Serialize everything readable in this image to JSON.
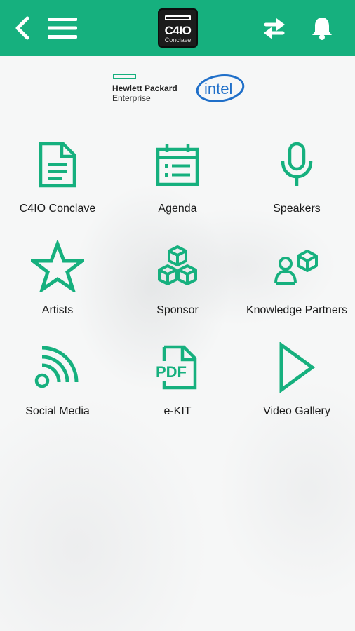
{
  "colors": {
    "accent": "#16b07e",
    "header_bg": "#16b07e",
    "text": "#1a1a1a"
  },
  "header": {
    "back_icon": "back-arrow-icon",
    "menu_icon": "hamburger-menu-icon",
    "logo": {
      "line1": "C4IO",
      "line2": "Conclave"
    },
    "sync_icon": "sync-icon",
    "notification_icon": "bell-icon"
  },
  "partners": {
    "hpe_line1": "Hewlett Packard",
    "hpe_line2": "Enterprise",
    "intel": "intel"
  },
  "tiles": [
    {
      "label": "C4IO Conclave",
      "icon": "document-icon"
    },
    {
      "label": "Agenda",
      "icon": "calendar-icon"
    },
    {
      "label": "Speakers",
      "icon": "microphone-icon"
    },
    {
      "label": "Artists",
      "icon": "star-icon"
    },
    {
      "label": "Sponsor",
      "icon": "cubes-icon"
    },
    {
      "label": "Knowledge Partners",
      "icon": "person-cube-icon"
    },
    {
      "label": "Social Media",
      "icon": "rss-icon"
    },
    {
      "label": "e-KIT",
      "icon": "pdf-icon"
    },
    {
      "label": "Video Gallery",
      "icon": "play-icon"
    }
  ]
}
